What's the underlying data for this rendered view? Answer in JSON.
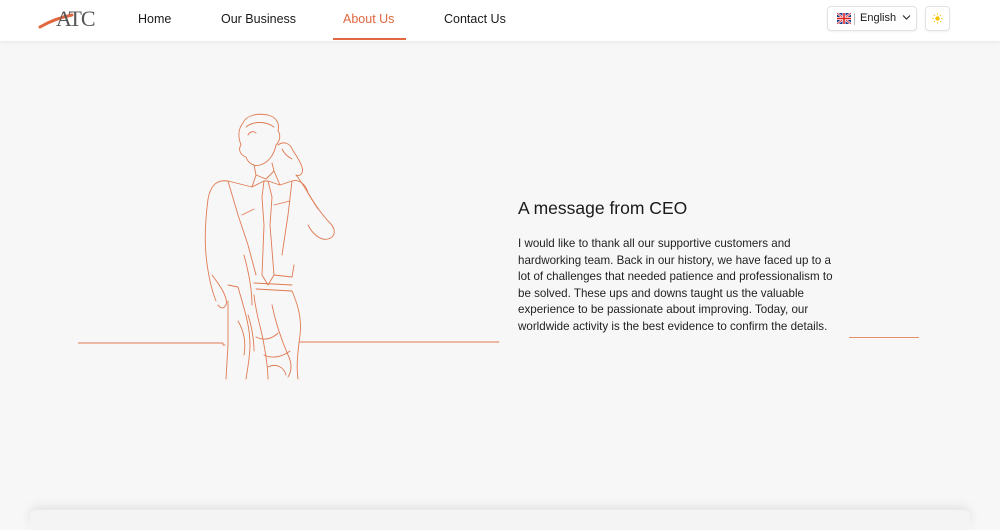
{
  "header": {
    "logo_text": "ATC",
    "nav": [
      {
        "label": "Home"
      },
      {
        "label": "Our Business"
      },
      {
        "label": "About Us"
      },
      {
        "label": "Contact Us"
      }
    ],
    "active_nav": "About Us",
    "language": {
      "selected": "English",
      "flag_icon": "uk-flag-icon"
    },
    "theme_icon": "sun-icon"
  },
  "colors": {
    "accent": "#e0673f",
    "line": "#e07a52",
    "background": "#f7f7f7",
    "header": "#ffffff"
  },
  "main": {
    "illustration": "businessman-line-art",
    "title": "A message from CEO",
    "message": "I would like to thank all our supportive customers and hardworking team. Back in our history, we have faced up to a lot of challenges that needed patience and professionalism to be solved. These ups and downs taught us the valuable experience to be passionate about improving. Today, our worldwide activity is the best evidence to confirm the details."
  }
}
